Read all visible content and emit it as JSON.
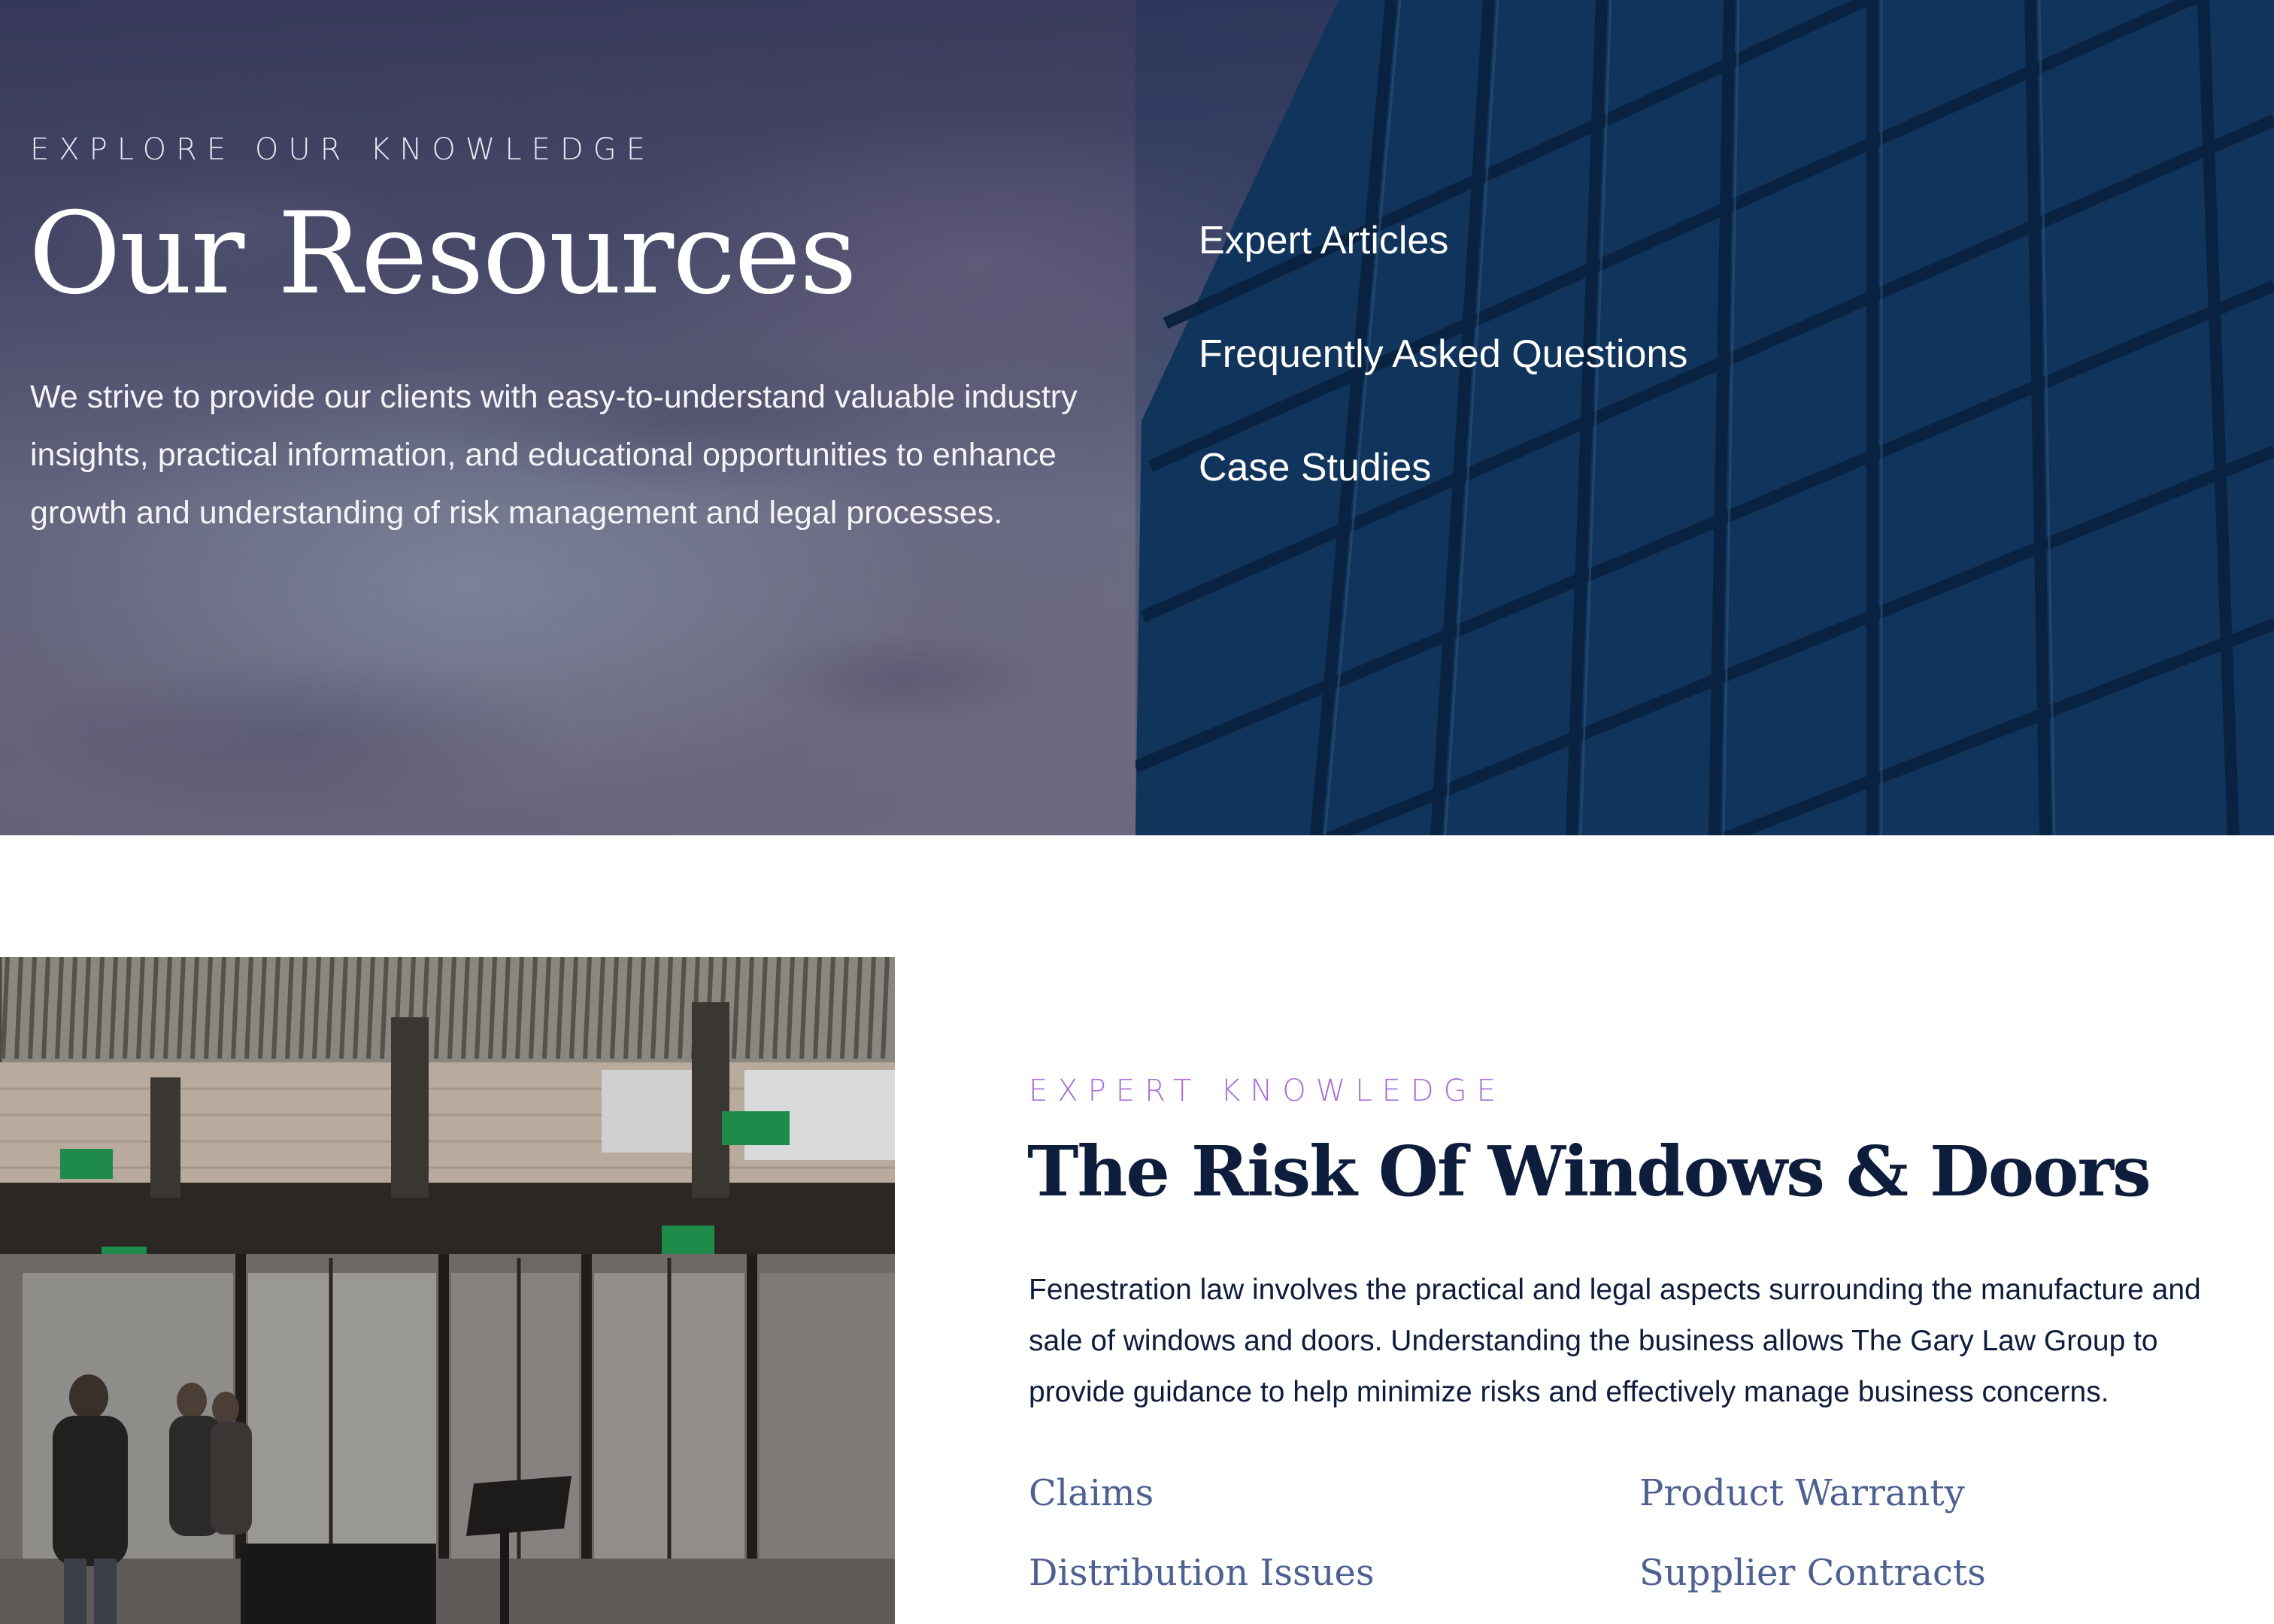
{
  "hero": {
    "eyebrow": "EXPLORE OUR KNOWLEDGE",
    "title": "Our Resources",
    "description": "We strive to provide our clients with easy-to-understand valuable industry insights, practical information, and educational opportunities to enhance growth and understanding of risk management and legal processes.",
    "links": [
      "Expert Articles",
      "Frequently Asked Questions",
      "Case Studies"
    ]
  },
  "section": {
    "eyebrow": "EXPERT KNOWLEDGE",
    "title": "The Risk Of Windows & Doors",
    "description": "Fenestration law involves the practical and legal aspects surrounding the manufacture and sale of windows and doors. Understanding the business allows The Gary Law Group to provide guidance to help minimize risks and effectively manage business concerns.",
    "topics": [
      "Claims",
      "Product Warranty",
      "Distribution Issues",
      "Supplier Contracts"
    ]
  },
  "colors": {
    "navy": "#0f1d3d",
    "accent_purple": "#a86fd4",
    "topic_link": "#4d6190",
    "building_glass": "#123458"
  }
}
